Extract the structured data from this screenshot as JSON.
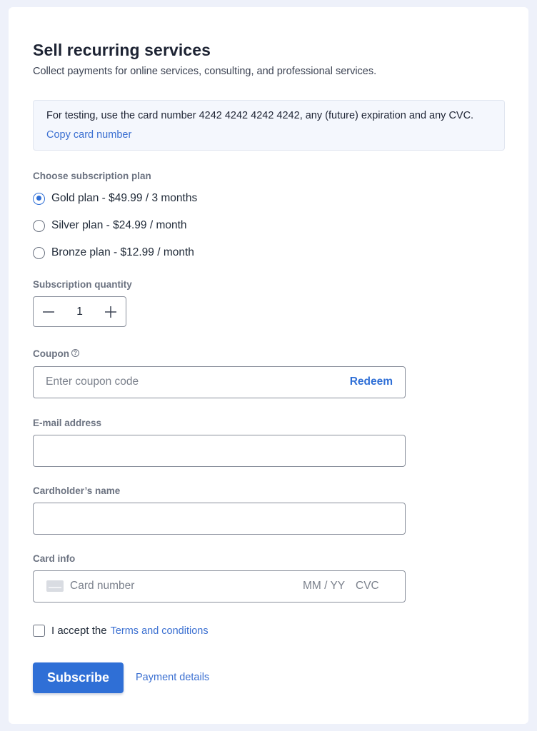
{
  "header": {
    "title": "Sell recurring services",
    "subtitle": "Collect payments for online services, consulting, and professional services."
  },
  "notice": {
    "text": "For testing, use the card number 4242 4242 4242 4242, any (future) expiration and any CVC.",
    "link": "Copy card number"
  },
  "plans": {
    "label": "Choose subscription plan",
    "options": [
      {
        "label": "Gold plan - $49.99 / 3 months",
        "selected": true
      },
      {
        "label": "Silver plan - $24.99 / month",
        "selected": false
      },
      {
        "label": "Bronze plan - $12.99 / month",
        "selected": false
      }
    ]
  },
  "quantity": {
    "label": "Subscription quantity",
    "value": "1",
    "decrement_icon": "minus-icon",
    "increment_icon": "plus-icon"
  },
  "coupon": {
    "label": "Coupon",
    "help_icon": "question-circle-icon",
    "placeholder": "Enter coupon code",
    "action": "Redeem"
  },
  "email": {
    "label": "E-mail address",
    "value": ""
  },
  "cardholder": {
    "label": "Cardholder’s name",
    "value": ""
  },
  "card_info": {
    "label": "Card info",
    "icon": "credit-card-icon",
    "number_placeholder": "Card number",
    "expiry_placeholder": "MM / YY",
    "cvc_placeholder": "CVC"
  },
  "terms": {
    "text": "I accept the",
    "link": "Terms and conditions",
    "checked": false
  },
  "actions": {
    "subscribe": "Subscribe",
    "payment_details": "Payment details"
  },
  "colors": {
    "accent": "#2f6fd6",
    "link": "#3a6fd1",
    "background": "#eef1fa"
  }
}
